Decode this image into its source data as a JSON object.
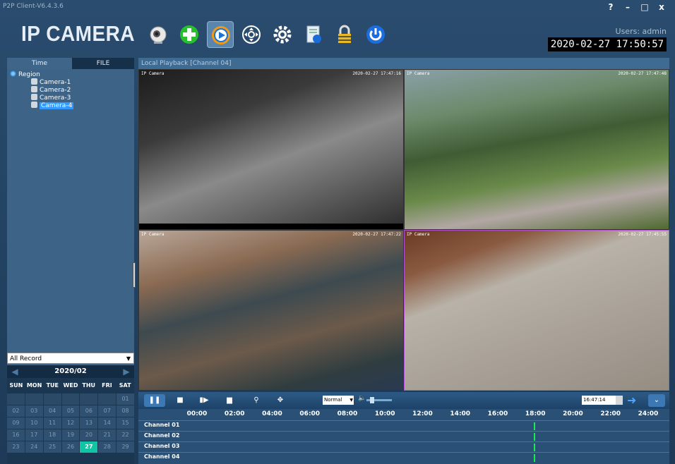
{
  "title_bar": {
    "version": "P2P Client-V6.4.3.6",
    "help": "?",
    "minimize": "–",
    "maximize": "□",
    "close": "x"
  },
  "header": {
    "logo": "IP CAMERA",
    "users": "Users: admin",
    "datetime": "2020-02-27 17:50:57"
  },
  "toolbar": {
    "items": [
      {
        "name": "camera-icon",
        "active": false
      },
      {
        "name": "add-device-icon",
        "active": false
      },
      {
        "name": "playback-icon",
        "active": true
      },
      {
        "name": "ptz-control-icon",
        "active": false
      },
      {
        "name": "settings-gear-icon",
        "active": false
      },
      {
        "name": "log-icon",
        "active": false
      },
      {
        "name": "lock-icon",
        "active": false
      },
      {
        "name": "power-icon",
        "active": false
      }
    ]
  },
  "left_panel": {
    "tabs": [
      {
        "label": "Time"
      },
      {
        "label": "FILE"
      }
    ],
    "tree": {
      "root": "Region",
      "cameras": [
        "Camera-1",
        "Camera-2",
        "Camera-3",
        "Camera-4"
      ],
      "selected": "Camera-4"
    },
    "filter": "All Record"
  },
  "calendar": {
    "month": "2020/02",
    "days_of_week": [
      "SUN",
      "MON",
      "TUE",
      "WED",
      "THU",
      "FRI",
      "SAT"
    ],
    "days": [
      "",
      "",
      "",
      "",
      "",
      "",
      "01",
      "02",
      "03",
      "04",
      "05",
      "06",
      "07",
      "08",
      "09",
      "10",
      "11",
      "12",
      "13",
      "14",
      "15",
      "16",
      "17",
      "18",
      "19",
      "20",
      "21",
      "22",
      "23",
      "24",
      "25",
      "26",
      "27",
      "28",
      "29"
    ],
    "today": "27"
  },
  "main": {
    "heading": "Local Playback [Channel 04]",
    "feeds": [
      {
        "label": "IP Camera",
        "timestamp": "2020-02-27 17:47:16"
      },
      {
        "label": "IP Camera",
        "timestamp": "2020-02-27 17:47:48"
      },
      {
        "label": "IP Camera",
        "timestamp": "2020-02-27 17:47:22"
      },
      {
        "label": "IP Camera",
        "timestamp": "2020-02-27 17:45:55"
      }
    ]
  },
  "controls": {
    "speed": "Normal",
    "jump_time": "16:47:14",
    "volume_level": 0.15
  },
  "timeline": {
    "hours": [
      "00:00",
      "02:00",
      "04:00",
      "06:00",
      "08:00",
      "10:00",
      "12:00",
      "14:00",
      "16:00",
      "18:00",
      "20:00",
      "22:00",
      "24:00"
    ],
    "channels": [
      "Channel 01",
      "Channel 02",
      "Channel 03",
      "Channel 04"
    ],
    "current_position_hours": 17.9
  },
  "colors": {
    "accent": "#3c78b4",
    "selection": "#3399ff",
    "today": "#11c5a4",
    "marker": "#16f04a",
    "active_feed_border": "#b24fd2"
  }
}
